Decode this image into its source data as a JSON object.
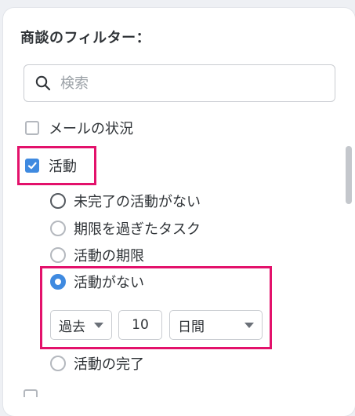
{
  "filter_panel": {
    "title": "商談のフィルター：",
    "search": {
      "placeholder": "検索",
      "value": ""
    },
    "options": {
      "email_status": {
        "label": "メールの状況",
        "checked": false
      },
      "activity": {
        "label": "活動",
        "checked": true
      }
    },
    "activity_radios": [
      {
        "label": "未完了の活動がない",
        "selected": false
      },
      {
        "label": "期限を過ぎたタスク",
        "selected": false
      },
      {
        "label": "活動の期限",
        "selected": false
      },
      {
        "label": "活動がない",
        "selected": true
      },
      {
        "label": "活動の完了",
        "selected": false
      }
    ],
    "no_activity_controls": {
      "period_select": "過去",
      "amount_value": "10",
      "unit_select": "日間"
    }
  },
  "colors": {
    "accent": "#3f8ae0",
    "highlight": "#e3116b",
    "text": "#2f3337"
  }
}
